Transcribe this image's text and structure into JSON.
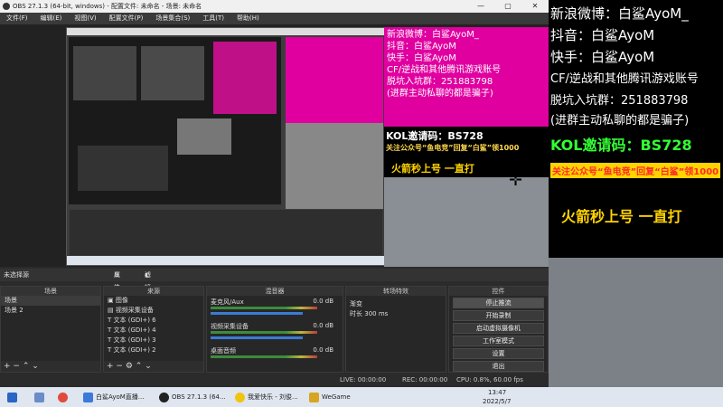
{
  "window": {
    "title": "OBS 27.1.3 (64-bit, windows) - 配置文件: 未命名 - 场景: 未命名",
    "btn_min": "—",
    "btn_max": "▢",
    "btn_close": "✕"
  },
  "menu": [
    "文件(F)",
    "编辑(E)",
    "视图(V)",
    "配置文件(P)",
    "场景集合(S)",
    "工具(T)",
    "帮助(H)"
  ],
  "overlay_magenta": [
    "新浪微博：白鲨AyoM_",
    "抖音：白鲨AyoM",
    "快手：白鲨AyoM",
    "CF/逆战和其他腾讯游戏账号",
    "脱坑入坑群：251883798",
    "(进群主动私聊的都是骗子)"
  ],
  "overlay_black": {
    "kol": "KOL邀请码：BS728",
    "promo": "关注公众号“鱼电竞”回复“白鲨”领1000",
    "rocket": "火箭秒上号 一直打"
  },
  "scene_bar": {
    "no_source": "未选择源",
    "props": "属性",
    "filters": "滤镜"
  },
  "scenes": {
    "header": "场景",
    "items": [
      "场景",
      "场景 2"
    ]
  },
  "sources": {
    "header": "来源",
    "items": [
      {
        "icon": "image-icon",
        "label": "图像"
      },
      {
        "icon": "camera-icon",
        "label": "视频采集设备"
      },
      {
        "icon": "text-icon",
        "label": "文本 (GDI+) 6"
      },
      {
        "icon": "text-icon",
        "label": "文本 (GDI+) 4"
      },
      {
        "icon": "text-icon",
        "label": "文本 (GDI+) 3"
      },
      {
        "icon": "text-icon",
        "label": "文本 (GDI+) 2"
      }
    ]
  },
  "mixer": {
    "header": "混音器",
    "channels": [
      {
        "name": "麦克风/Aux",
        "db": "0.0 dB"
      },
      {
        "name": "视频采集设备",
        "db": "0.0 dB"
      },
      {
        "name": "桌面音频",
        "db": "0.0 dB"
      }
    ]
  },
  "transitions": {
    "header": "转场特效",
    "type": "渐变",
    "duration_label": "时长",
    "duration": "300 ms"
  },
  "controls": {
    "header": "控件",
    "buttons": [
      "停止推流",
      "开始录制",
      "启动虚拟摄像机",
      "工作室模式",
      "设置",
      "退出"
    ]
  },
  "status": {
    "live": "LIVE: 00:00:00",
    "rec": "REC: 00:00:00",
    "cpu": "CPU: 0.8%, 60.00 fps"
  },
  "taskbar": {
    "items": [
      "白鲨AyoM直播...",
      "OBS 27.1.3 (64...",
      "我爱快乐 - 刘俊...",
      "WeGame"
    ],
    "time": "13:47",
    "date": "2022/5/7"
  },
  "right_panel": {
    "weibo": "新浪微博：白鲨AyoM_",
    "douyin": "抖音：白鲨AyoM",
    "kuaishou": "快手：白鲨AyoM",
    "cf": "CF/逆战和其他腾讯游戏账号",
    "group": "脱坑入坑群：251883798",
    "warn": "(进群主动私聊的都是骗子)",
    "kol": "KOL邀请码：BS728",
    "promo": "关注公众号“鱼电竞”回复“白鲨”领1000",
    "rocket": "火箭秒上号 一直打"
  },
  "colors": {
    "magenta": "#e000a0",
    "kol_green": "#33ff33",
    "rocket_yellow": "#ffd400",
    "promo_red": "#ff2a2a",
    "accent_blue": "#3a7bd5"
  }
}
